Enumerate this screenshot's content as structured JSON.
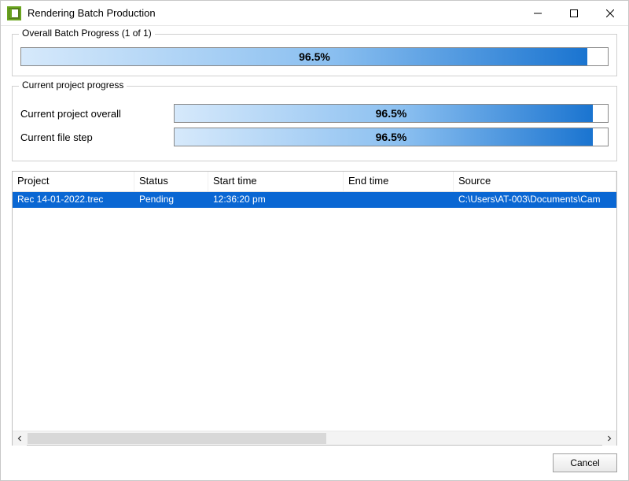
{
  "window": {
    "title": "Rendering Batch Production"
  },
  "overall": {
    "group_label": "Overall Batch Progress (1 of 1)",
    "percent_text": "96.5%",
    "percent_value": 96.5
  },
  "project_progress": {
    "group_label": "Current project progress",
    "overall_label": "Current project overall",
    "overall_percent_text": "96.5%",
    "overall_percent_value": 96.5,
    "filestep_label": "Current file step",
    "filestep_percent_text": "96.5%",
    "filestep_percent_value": 96.5
  },
  "table": {
    "headers": {
      "project": "Project",
      "status": "Status",
      "start_time": "Start time",
      "end_time": "End time",
      "source": "Source"
    },
    "rows": [
      {
        "project": "Rec 14-01-2022.trec",
        "status": "Pending",
        "start_time": "12:36:20 pm",
        "end_time": "",
        "source": "C:\\Users\\AT-003\\Documents\\Cam"
      }
    ]
  },
  "buttons": {
    "cancel": "Cancel"
  }
}
